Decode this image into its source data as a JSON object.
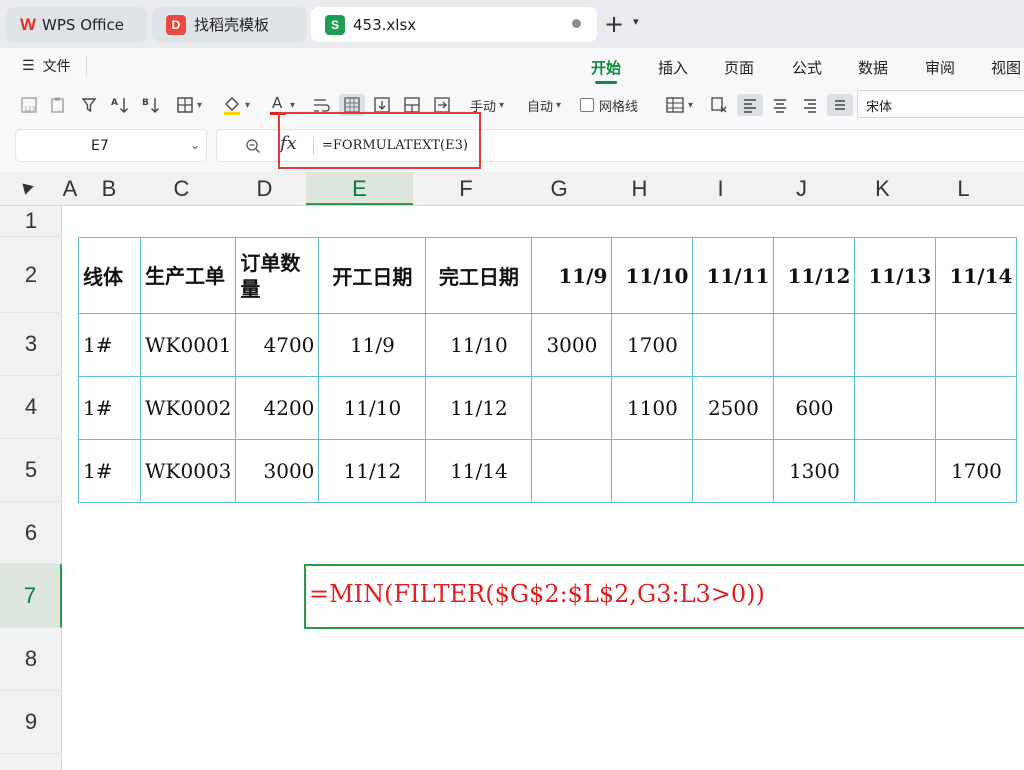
{
  "tabs": {
    "wps": "WPS Office",
    "template": "找稻壳模板",
    "file": "453.xlsx",
    "file_badge": "S",
    "template_badge": "D",
    "new_tab": "+"
  },
  "menu": {
    "file_menu": "文件",
    "ribbon_tabs": [
      "开始",
      "插入",
      "页面",
      "公式",
      "数据",
      "审阅",
      "视图"
    ],
    "active_tab": "开始"
  },
  "toolbar": {
    "manual_label": "手动",
    "auto_label": "自动",
    "gridlines_label": "网格线",
    "font_name": "宋体",
    "font_color": "#e02020",
    "fill_color": "#f5d300"
  },
  "formula_bar": {
    "cell_ref": "E7",
    "fx": "fx",
    "formula": "=FORMULATEXT(E3)"
  },
  "sheet": {
    "columns": [
      "A",
      "B",
      "C",
      "D",
      "E",
      "F",
      "G",
      "H",
      "I",
      "J",
      "K",
      "L"
    ],
    "selected_column": "E",
    "rows": [
      "1",
      "2",
      "3",
      "4",
      "5",
      "6",
      "7",
      "8",
      "9"
    ],
    "selected_row": "7",
    "table": {
      "header": [
        "线体",
        "生产工单",
        "订单数量",
        "开工日期",
        "完工日期",
        "11/9",
        "11/10",
        "11/11",
        "11/12",
        "11/13",
        "11/14"
      ],
      "rows": [
        [
          "1#",
          "WK0001",
          "4700",
          "11/9",
          "11/10",
          "3000",
          "1700",
          "",
          "",
          "",
          ""
        ],
        [
          "1#",
          "WK0002",
          "4200",
          "11/10",
          "11/12",
          "",
          "1100",
          "2500",
          "600",
          "",
          ""
        ],
        [
          "1#",
          "WK0003",
          "3000",
          "11/12",
          "11/14",
          "",
          "",
          "",
          "1300",
          "",
          "1700"
        ]
      ]
    },
    "e7_display": "=MIN(FILTER($G$2:$L$2,G3:L3>0))"
  },
  "colors": {
    "accent": "#0d8a3a",
    "highlight_box": "#e53935",
    "table_border": "#5bc0d4",
    "formula_text": "#e02020"
  }
}
